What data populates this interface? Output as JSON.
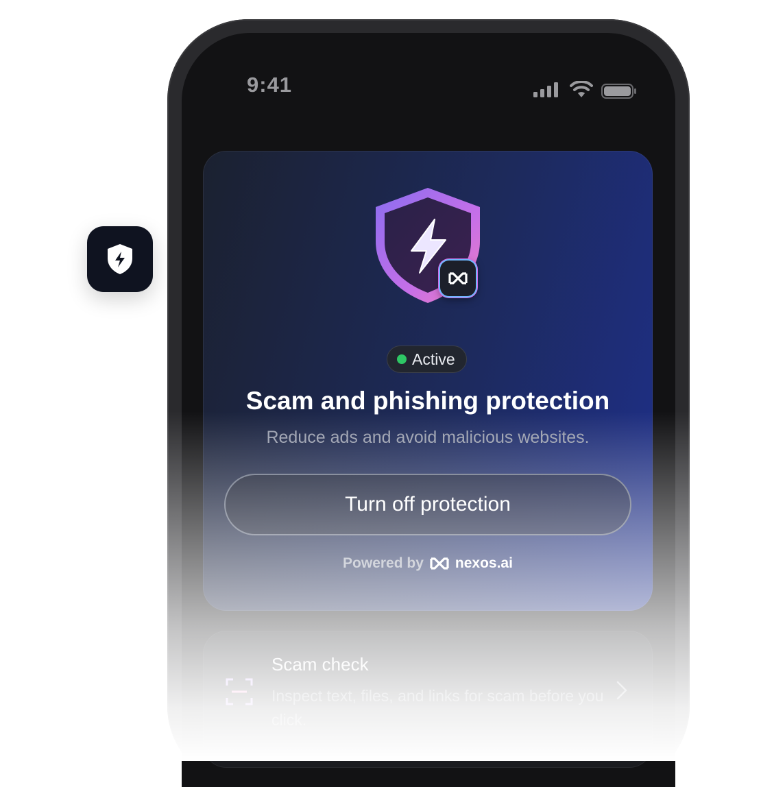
{
  "status_bar": {
    "time": "9:41",
    "signal_icon": "cellular-signal-icon",
    "wifi_icon": "wifi-icon",
    "battery_icon": "battery-icon"
  },
  "app_badge": {
    "icon": "shield-bolt-icon"
  },
  "protection_card": {
    "hero_icon": "shield-bolt-icon",
    "brand_tile_icon": "nexos-logo-icon",
    "status": "Active",
    "status_color": "#2ec765",
    "title": "Scam and phishing protection",
    "subtitle": "Reduce ads and avoid malicious websites.",
    "button_label": "Turn off protection",
    "powered_by": "Powered by",
    "brand": "nexos.ai"
  },
  "scam_check_card": {
    "icon": "scan-icon",
    "title": "Scam check",
    "description": "Inspect text, files, and links for scam before you click.",
    "chevron_icon": "chevron-right-icon"
  },
  "colors": {
    "card_gradient_start": "#1b2130",
    "card_gradient_end": "#1e2f8a",
    "phone_screen": "#121214",
    "app_badge_bg": "#0f1320"
  }
}
